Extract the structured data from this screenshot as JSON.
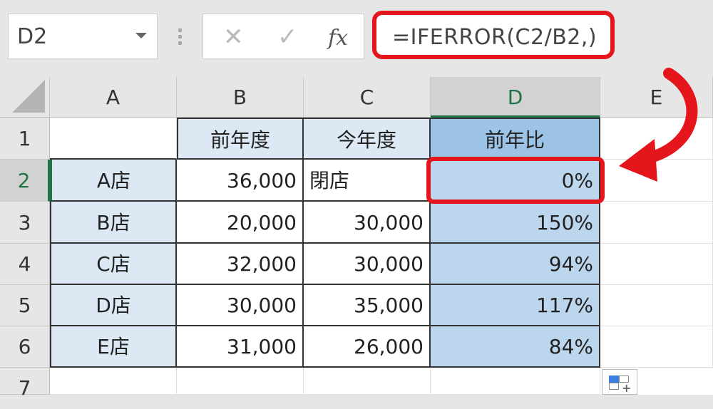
{
  "formula_bar": {
    "name_box": "D2",
    "cancel_icon": "✕",
    "enter_icon": "✓",
    "fx_label": "fx",
    "formula": "=IFERROR(C2/B2,)"
  },
  "columns": [
    "A",
    "B",
    "C",
    "D",
    "E"
  ],
  "rows": [
    "1",
    "2",
    "3",
    "4",
    "5",
    "6",
    "7"
  ],
  "table": {
    "headers": [
      "",
      "前年度",
      "今年度",
      "前年比"
    ],
    "body": [
      [
        "A店",
        "36,000",
        "閉店",
        "0%"
      ],
      [
        "B店",
        "20,000",
        "30,000",
        "150%"
      ],
      [
        "C店",
        "32,000",
        "30,000",
        "94%"
      ],
      [
        "D店",
        "30,000",
        "35,000",
        "117%"
      ],
      [
        "E店",
        "31,000",
        "26,000",
        "84%"
      ]
    ]
  },
  "selected_cell": "D2",
  "colors": {
    "highlight_red": "#e4161b",
    "excel_green": "#217346",
    "cell_blue_light": "#dce9f5",
    "cell_blue": "#bcd6ee"
  }
}
